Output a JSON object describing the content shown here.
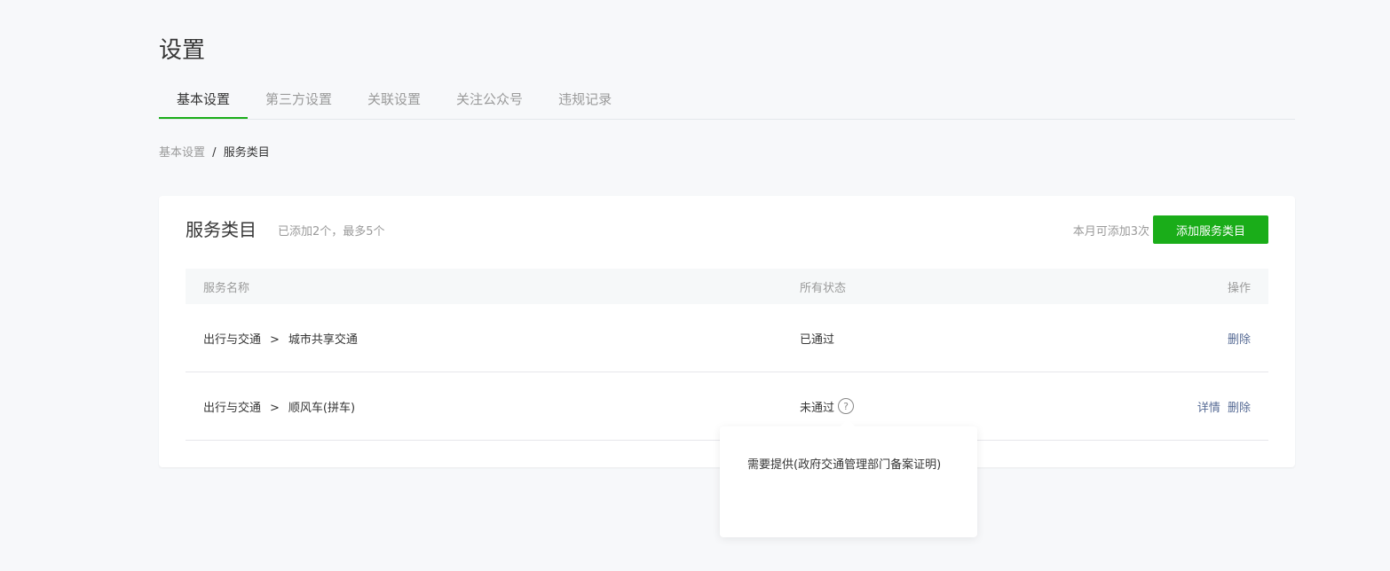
{
  "page": {
    "title": "设置"
  },
  "tabs": [
    {
      "label": "基本设置",
      "active": true
    },
    {
      "label": "第三方设置"
    },
    {
      "label": "关联设置"
    },
    {
      "label": "关注公众号"
    },
    {
      "label": "违规记录"
    }
  ],
  "breadcrumb": {
    "parent": "基本设置",
    "separator": "/",
    "current": "服务类目"
  },
  "card": {
    "title": "服务类目",
    "subtitle": "已添加2个，最多5个",
    "quota_text": "本月可添加3次",
    "add_button_label": "添加服务类目"
  },
  "table": {
    "headers": {
      "name": "服务名称",
      "status": "所有状态",
      "action": "操作"
    },
    "rows": [
      {
        "category": "出行与交通",
        "separator": ">",
        "subcategory": "城市共享交通",
        "status": "已通过",
        "actions": {
          "delete": "删除"
        }
      },
      {
        "category": "出行与交通",
        "separator": ">",
        "subcategory": "顺风车(拼车)",
        "status": "未通过",
        "help_icon": "?",
        "actions": {
          "details": "详情",
          "delete": "删除"
        }
      }
    ]
  },
  "tooltip": {
    "text": "需要提供(政府交通管理部门备案证明)"
  },
  "colors": {
    "accent": "#1aad19",
    "link": "#576b95",
    "muted": "#9a9a9a",
    "text": "#353535"
  }
}
